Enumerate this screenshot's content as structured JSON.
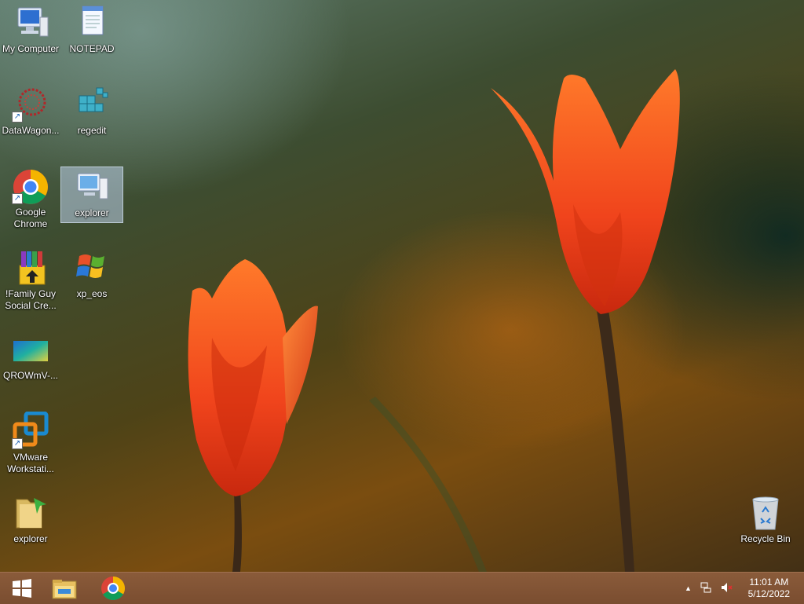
{
  "desktop": {
    "icons": [
      {
        "label": "My Computer"
      },
      {
        "label": "NOTEPAD"
      },
      {
        "label": "DataWagon..."
      },
      {
        "label": "regedit"
      },
      {
        "label": "Google Chrome"
      },
      {
        "label": "explorer"
      },
      {
        "label": "!Family Guy Social Cre..."
      },
      {
        "label": "xp_eos"
      },
      {
        "label": "QROWmV-..."
      },
      {
        "label": "VMware Workstati..."
      },
      {
        "label": "explorer"
      },
      {
        "label": "Recycle Bin"
      }
    ]
  },
  "taskbar": {
    "time": "11:01 AM",
    "date": "5/12/2022",
    "tray_chevron": "▲",
    "pinned": [
      {
        "icon": "windows-start-icon"
      },
      {
        "icon": "file-explorer-icon"
      },
      {
        "icon": "chrome-icon"
      }
    ]
  }
}
